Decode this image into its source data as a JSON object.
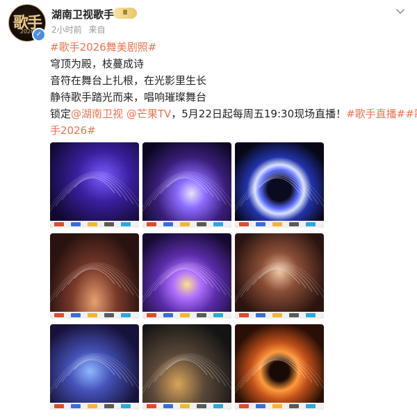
{
  "account": {
    "name": "湖南卫视歌手",
    "avatar_text": "歌手",
    "avatar_year": "2026",
    "level_badge": "Ⅱ",
    "time": "2小时前",
    "source": "来自"
  },
  "post": {
    "lines": [
      [
        {
          "t": "tag",
          "v": "#歌手2026舞美剧照#"
        }
      ],
      [
        {
          "t": "text",
          "v": "穹顶为殿，枝蔓成诗"
        }
      ],
      [
        {
          "t": "text",
          "v": "音符在舞台上扎根，在光影里生长"
        }
      ],
      [
        {
          "t": "text",
          "v": "静待歌手踏光而来，唱响璀璨舞台"
        }
      ],
      [
        {
          "t": "text",
          "v": "锁定"
        },
        {
          "t": "mention",
          "v": "@湖南卫视"
        },
        {
          "t": "text",
          "v": " "
        },
        {
          "t": "mention",
          "v": "@芒果TV"
        },
        {
          "t": "text",
          "v": "，5月22日起每周五19:30现场直播！"
        },
        {
          "t": "tag",
          "v": "#歌手直播##歌"
        }
      ],
      [
        {
          "t": "tag",
          "v": "手2026#"
        }
      ]
    ]
  },
  "images": [
    {
      "name": "stage-photo-1"
    },
    {
      "name": "stage-photo-2"
    },
    {
      "name": "stage-photo-3"
    },
    {
      "name": "stage-photo-4"
    },
    {
      "name": "stage-photo-5"
    },
    {
      "name": "stage-photo-6"
    },
    {
      "name": "stage-photo-7"
    },
    {
      "name": "stage-photo-8"
    },
    {
      "name": "stage-photo-9"
    }
  ],
  "colors": {
    "accent": "#eb7350",
    "verified": "#4a90e2"
  },
  "icons": {
    "verified": "verified-icon",
    "chevron": "chevron-down-icon",
    "level": "level-badge-icon"
  }
}
